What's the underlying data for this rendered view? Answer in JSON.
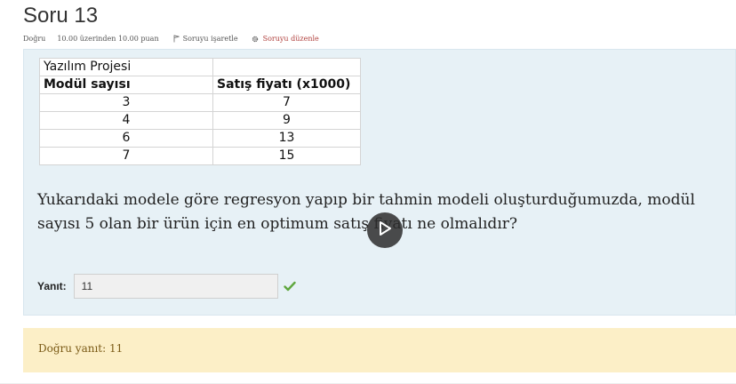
{
  "question": {
    "title": "Soru 13",
    "meta": {
      "status": "Doğru",
      "grade": "10.00 üzerinden 10.00 puan",
      "flag_label": "Soruyu işaretle",
      "edit_label": "Soruyu düzenle"
    },
    "table": {
      "caption": "Yazılım Projesi",
      "headers": [
        "Modül sayısı",
        "Satış fiyatı (x1000)"
      ],
      "rows": [
        [
          "3",
          "7"
        ],
        [
          "4",
          "9"
        ],
        [
          "6",
          "13"
        ],
        [
          "7",
          "15"
        ]
      ]
    },
    "text_line1": "Yukarıdaki modele göre regresyon yapıp bir tahmin modeli oluşturduğumuzda, modül",
    "text_line2": "sayısı 5 olan bir ürün için en optimum satış fiyatı ne olmalıdır?",
    "answer": {
      "label": "Yanıt:",
      "value": "11"
    }
  },
  "feedback": {
    "correct_answer": "Doğru yanıt: 11"
  },
  "icons": {
    "flag": "flag-icon",
    "edit": "gear-icon",
    "correct": "check-icon",
    "video": "play-icon"
  },
  "colors": {
    "content_bg": "#e7f1f6",
    "feedback_bg": "#fcefc7",
    "edit_link": "#b0413e",
    "correct_check": "#5fa73e"
  }
}
